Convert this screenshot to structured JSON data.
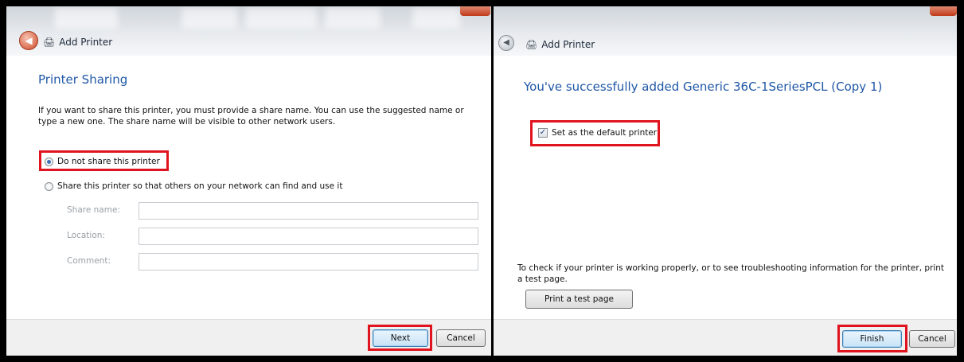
{
  "left_dialog": {
    "title": "Add Printer",
    "heading": "Printer Sharing",
    "description": "If you want to share this printer, you must provide a share name. You can use the suggested name or type a new one. The share name will be visible to other network users.",
    "option_no_share": "Do not share this printer",
    "option_share": "Share this printer so that others on your network can find and use it",
    "share_name_label": "Share name:",
    "location_label": "Location:",
    "comment_label": "Comment:",
    "share_name_value": "",
    "location_value": "",
    "comment_value": "",
    "next_label": "Next",
    "cancel_label": "Cancel",
    "selected_option": "no_share"
  },
  "right_dialog": {
    "title": "Add Printer",
    "heading": "You've successfully added Generic 36C-1SeriesPCL (Copy 1)",
    "default_checkbox_label": "Set as the default printer",
    "default_checked": true,
    "test_info": "To check if your printer is working properly, or to see troubleshooting information for the printer, print a test page.",
    "print_test_label": "Print a test page",
    "finish_label": "Finish",
    "cancel_label": "Cancel"
  },
  "icons": {
    "back": "back-arrow-icon",
    "printer": "printer-icon",
    "check": "checkmark-icon"
  },
  "colors": {
    "heading": "#1f57a6",
    "highlight": "#e0141e"
  }
}
